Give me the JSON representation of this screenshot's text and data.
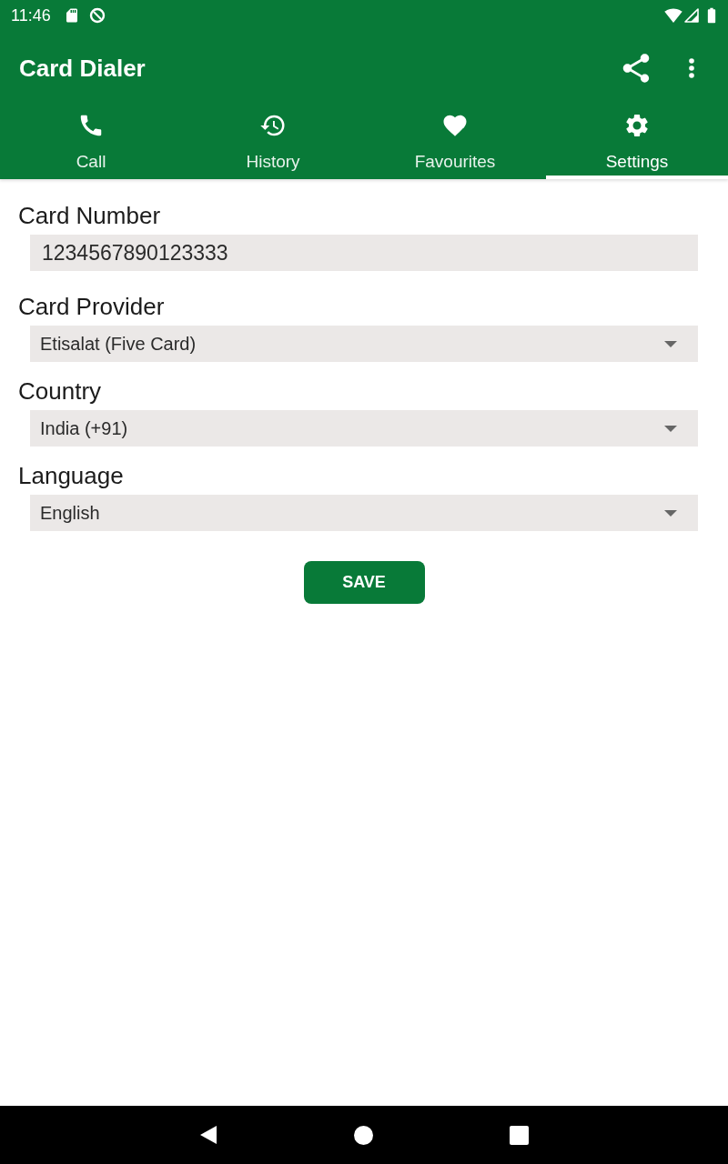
{
  "status_bar": {
    "time": "11:46"
  },
  "app_bar": {
    "title": "Card Dialer"
  },
  "tabs": [
    {
      "label": "Call",
      "selected": false
    },
    {
      "label": "History",
      "selected": false
    },
    {
      "label": "Favourites",
      "selected": false
    },
    {
      "label": "Settings",
      "selected": true
    }
  ],
  "fields": [
    {
      "kind": "text",
      "label": "Card Number",
      "value": "1234567890123333"
    },
    {
      "kind": "dropdown",
      "label": "Card Provider",
      "value": "Etisalat (Five Card)"
    },
    {
      "kind": "dropdown",
      "label": "Country",
      "value": "India (+91)"
    },
    {
      "kind": "dropdown",
      "label": "Language",
      "value": "English"
    }
  ],
  "save_button": {
    "label": "SAVE"
  }
}
